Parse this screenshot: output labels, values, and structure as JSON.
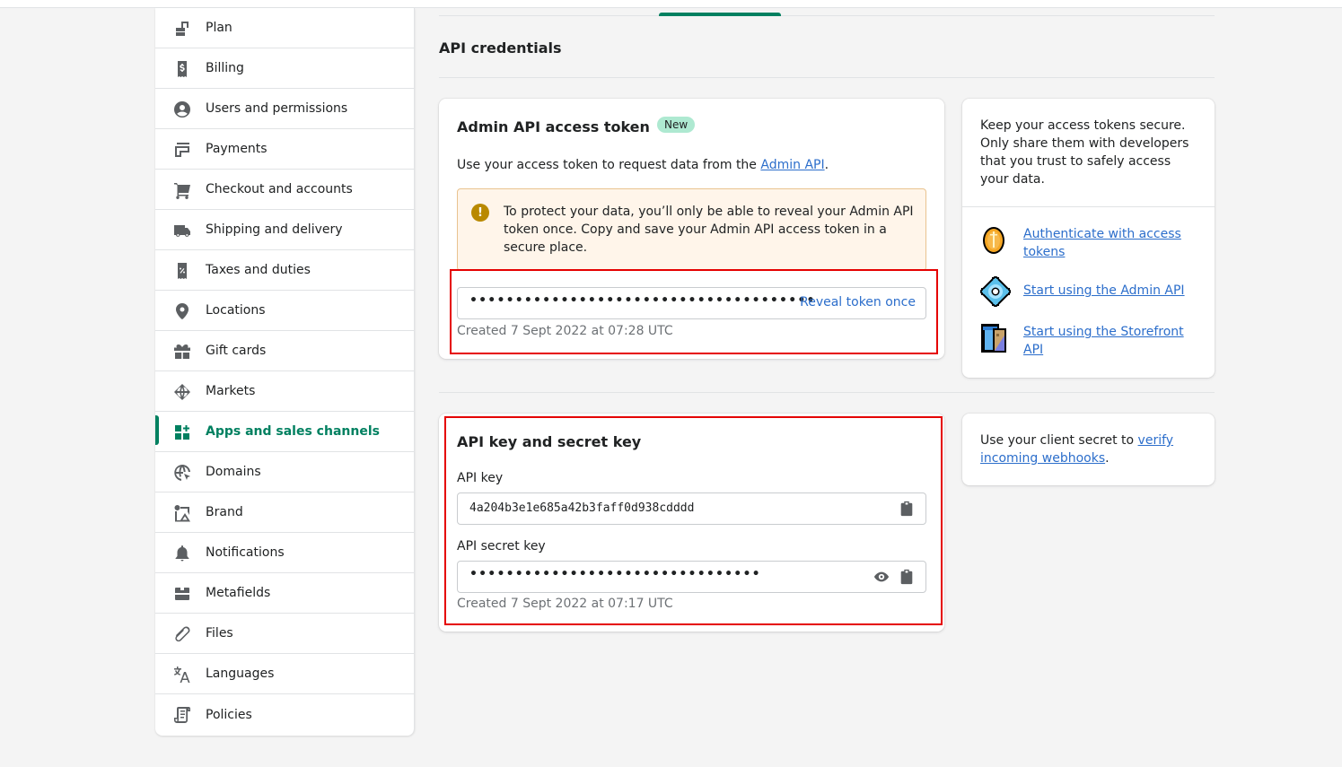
{
  "sidebar": {
    "items": [
      {
        "label": "Plan",
        "icon": "plan-icon",
        "active": false
      },
      {
        "label": "Billing",
        "icon": "billing-icon",
        "active": false
      },
      {
        "label": "Users and permissions",
        "icon": "user-icon",
        "active": false
      },
      {
        "label": "Payments",
        "icon": "payments-icon",
        "active": false
      },
      {
        "label": "Checkout and accounts",
        "icon": "cart-icon",
        "active": false
      },
      {
        "label": "Shipping and delivery",
        "icon": "truck-icon",
        "active": false
      },
      {
        "label": "Taxes and duties",
        "icon": "tax-receipt-icon",
        "active": false
      },
      {
        "label": "Locations",
        "icon": "location-pin-icon",
        "active": false
      },
      {
        "label": "Gift cards",
        "icon": "gift-icon",
        "active": false
      },
      {
        "label": "Markets",
        "icon": "globe-markets-icon",
        "active": false
      },
      {
        "label": "Apps and sales channels",
        "icon": "apps-icon",
        "active": true
      },
      {
        "label": "Domains",
        "icon": "domains-globe-icon",
        "active": false
      },
      {
        "label": "Brand",
        "icon": "brand-icon",
        "active": false
      },
      {
        "label": "Notifications",
        "icon": "bell-icon",
        "active": false
      },
      {
        "label": "Metafields",
        "icon": "metafields-icon",
        "active": false
      },
      {
        "label": "Files",
        "icon": "paperclip-icon",
        "active": false
      },
      {
        "label": "Languages",
        "icon": "translate-icon",
        "active": false
      },
      {
        "label": "Policies",
        "icon": "policy-scroll-icon",
        "active": false
      }
    ]
  },
  "main": {
    "section_title": "API credentials",
    "token_card": {
      "title": "Admin API access token",
      "badge": "New",
      "desc_prefix": "Use your access token to request data from the ",
      "desc_link": "Admin API",
      "desc_suffix": ".",
      "banner_icon": "warning-icon",
      "banner_text": "To protect your data, you’ll only be able to reveal your Admin API token once. Copy and save your Admin API access token in a secure place.",
      "token_masked": "••••••••••••••••••••••••••••••••••••••",
      "reveal_label": "Reveal token once",
      "created": "Created 7 Sept 2022 at 07:28 UTC"
    },
    "keys_card": {
      "title": "API key and secret key",
      "api_key_label": "API key",
      "api_key_value": "4a204b3e1e685a42b3faff0d938cdddd",
      "secret_label": "API secret key",
      "secret_masked": "••••••••••••••••••••••••••••••••",
      "created": "Created 7 Sept 2022 at 07:17 UTC"
    },
    "side_card": {
      "text": "Keep your access tokens secure. Only share them with developers that you trust to safely access your data.",
      "resources": [
        {
          "label": "Authenticate with access tokens",
          "icon": "coin-icon"
        },
        {
          "label": "Start using the Admin API",
          "icon": "gear-icon"
        },
        {
          "label": "Start using the Storefront API",
          "icon": "storefront-blueprint-icon"
        }
      ]
    },
    "webhook_card": {
      "text_prefix": "Use your client secret to ",
      "link": "verify incoming webhooks",
      "text_suffix": "."
    }
  },
  "colors": {
    "accent": "#008060",
    "link": "#2c6ecb",
    "highlight": "#e50000",
    "warning_bg": "#fff5ea",
    "badge_bg": "#aee9d1"
  }
}
